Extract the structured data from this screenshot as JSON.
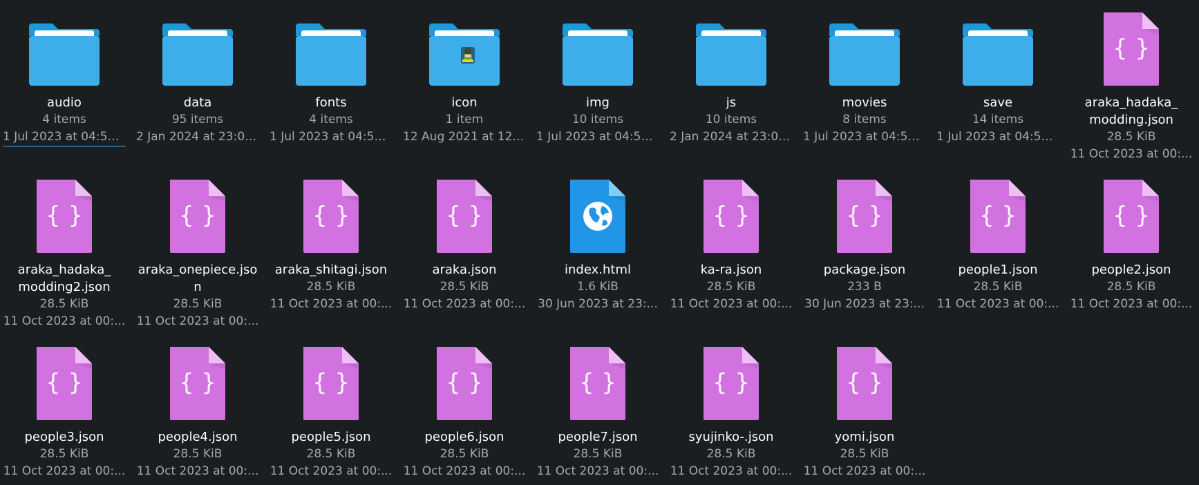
{
  "view": "file-manager-icons",
  "colors": {
    "background": "#1b1e20",
    "folder": "#3daee9",
    "folder_tab": "#1d99d6",
    "json_file": "#d272e0",
    "html_file": "#2196e8",
    "focus_line": "#3daee9"
  },
  "items": [
    {
      "name": "audio",
      "info": "4 items",
      "date": "1 Jul 2023 at 04:52:...",
      "kind": "folder",
      "icon": "folder-icon",
      "focused": true
    },
    {
      "name": "data",
      "info": "95 items",
      "date": "2 Jan 2024 at 23:02...",
      "kind": "folder",
      "icon": "folder-icon"
    },
    {
      "name": "fonts",
      "info": "4 items",
      "date": "1 Jul 2023 at 04:52:...",
      "kind": "folder",
      "icon": "folder-icon"
    },
    {
      "name": "icon",
      "info": "1 item",
      "date": "12 Aug 2021 at 12:...",
      "kind": "folder",
      "icon": "folder-with-thumbnail-icon"
    },
    {
      "name": "img",
      "info": "10 items",
      "date": "1 Jul 2023 at 04:52:...",
      "kind": "folder",
      "icon": "folder-icon"
    },
    {
      "name": "js",
      "info": "10 items",
      "date": "2 Jan 2024 at 23:02...",
      "kind": "folder",
      "icon": "folder-icon"
    },
    {
      "name": "movies",
      "info": "8 items",
      "date": "1 Jul 2023 at 04:52:...",
      "kind": "folder",
      "icon": "folder-icon"
    },
    {
      "name": "save",
      "info": "14 items",
      "date": "1 Jul 2023 at 04:52:...",
      "kind": "folder",
      "icon": "folder-icon"
    },
    {
      "name": "araka_hadaka_\nmodding.json",
      "info": "28.5 KiB",
      "date": "11 Oct 2023 at 00:...",
      "kind": "json",
      "icon": "json-file-icon"
    },
    {
      "name": "araka_hadaka_\nmodding2.json",
      "info": "28.5 KiB",
      "date": "11 Oct 2023 at 00:...",
      "kind": "json",
      "icon": "json-file-icon"
    },
    {
      "name": "araka_onepiece.json",
      "info": "28.5 KiB",
      "date": "11 Oct 2023 at 00:...",
      "kind": "json",
      "icon": "json-file-icon"
    },
    {
      "name": "araka_shitagi.json",
      "info": "28.5 KiB",
      "date": "11 Oct 2023 at 00:...",
      "kind": "json",
      "icon": "json-file-icon"
    },
    {
      "name": "araka.json",
      "info": "28.5 KiB",
      "date": "11 Oct 2023 at 00:...",
      "kind": "json",
      "icon": "json-file-icon"
    },
    {
      "name": "index.html",
      "info": "1.6 KiB",
      "date": "30 Jun 2023 at 23:...",
      "kind": "html",
      "icon": "html-file-icon"
    },
    {
      "name": "ka-ra.json",
      "info": "28.5 KiB",
      "date": "11 Oct 2023 at 00:...",
      "kind": "json",
      "icon": "json-file-icon"
    },
    {
      "name": "package.json",
      "info": "233 B",
      "date": "30 Jun 2023 at 23:...",
      "kind": "json",
      "icon": "json-file-icon"
    },
    {
      "name": "people1.json",
      "info": "28.5 KiB",
      "date": "11 Oct 2023 at 00:...",
      "kind": "json",
      "icon": "json-file-icon"
    },
    {
      "name": "people2.json",
      "info": "28.5 KiB",
      "date": "11 Oct 2023 at 00:...",
      "kind": "json",
      "icon": "json-file-icon"
    },
    {
      "name": "people3.json",
      "info": "28.5 KiB",
      "date": "11 Oct 2023 at 00:...",
      "kind": "json",
      "icon": "json-file-icon"
    },
    {
      "name": "people4.json",
      "info": "28.5 KiB",
      "date": "11 Oct 2023 at 00:...",
      "kind": "json",
      "icon": "json-file-icon"
    },
    {
      "name": "people5.json",
      "info": "28.5 KiB",
      "date": "11 Oct 2023 at 00:...",
      "kind": "json",
      "icon": "json-file-icon"
    },
    {
      "name": "people6.json",
      "info": "28.5 KiB",
      "date": "11 Oct 2023 at 00:...",
      "kind": "json",
      "icon": "json-file-icon"
    },
    {
      "name": "people7.json",
      "info": "28.5 KiB",
      "date": "11 Oct 2023 at 00:...",
      "kind": "json",
      "icon": "json-file-icon"
    },
    {
      "name": "syujinko-.json",
      "info": "28.5 KiB",
      "date": "11 Oct 2023 at 00:...",
      "kind": "json",
      "icon": "json-file-icon"
    },
    {
      "name": "yomi.json",
      "info": "28.5 KiB",
      "date": "11 Oct 2023 at 00:...",
      "kind": "json",
      "icon": "json-file-icon"
    }
  ]
}
